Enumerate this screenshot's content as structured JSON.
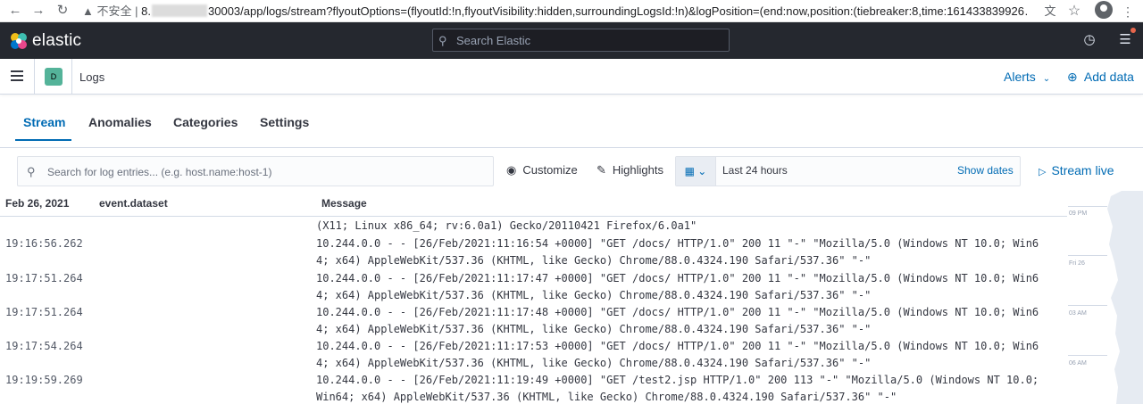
{
  "browser": {
    "security_label": "不安全",
    "host_prefix": "8.",
    "url_path": "30003/app/logs/stream?flyoutOptions=(flyoutId:!n,flyoutVisibility:hidden,surroundingLogsId:!n)&logPosition=(end:now,position:(tiebreaker:8,time:161433839926…",
    "back_icon": "arrow-left-icon",
    "forward_icon": "arrow-right-icon",
    "reload_icon": "reload-icon",
    "translate_icon": "translate-icon",
    "star_icon": "star-icon",
    "menu_icon": "kebab-icon"
  },
  "header": {
    "logo_text": "elastic",
    "search_placeholder": "Search Elastic"
  },
  "appbar": {
    "space_initial": "D",
    "breadcrumb": "Logs",
    "alerts_label": "Alerts",
    "add_data_label": "Add data"
  },
  "tabs": [
    {
      "label": "Stream",
      "active": true
    },
    {
      "label": "Anomalies",
      "active": false
    },
    {
      "label": "Categories",
      "active": false
    },
    {
      "label": "Settings",
      "active": false
    }
  ],
  "toolbar": {
    "search_placeholder": "Search for log entries... (e.g. host.name:host-1)",
    "customize_label": "Customize",
    "highlights_label": "Highlights",
    "date_range_label": "Last 24 hours",
    "show_dates_label": "Show dates",
    "stream_live_label": "Stream live"
  },
  "table": {
    "columns": [
      "Feb 26, 2021",
      "event.dataset",
      "Message"
    ],
    "rows": [
      {
        "time": "",
        "message": "(X11; Linux x86_64; rv:6.0a1) Gecko/20110421 Firefox/6.0a1\""
      },
      {
        "time": "19:16:56.262",
        "message": "10.244.0.0 - - [26/Feb/2021:11:16:54 +0000] \"GET /docs/ HTTP/1.0\" 200 11 \"-\" \"Mozilla/5.0 (Windows NT 10.0; Win6\n4; x64) AppleWebKit/537.36 (KHTML, like Gecko) Chrome/88.0.4324.190 Safari/537.36\" \"-\""
      },
      {
        "time": "19:17:51.264",
        "message": "10.244.0.0 - - [26/Feb/2021:11:17:47 +0000] \"GET /docs/ HTTP/1.0\" 200 11 \"-\" \"Mozilla/5.0 (Windows NT 10.0; Win6\n4; x64) AppleWebKit/537.36 (KHTML, like Gecko) Chrome/88.0.4324.190 Safari/537.36\" \"-\""
      },
      {
        "time": "19:17:51.264",
        "message": "10.244.0.0 - - [26/Feb/2021:11:17:48 +0000] \"GET /docs/ HTTP/1.0\" 200 11 \"-\" \"Mozilla/5.0 (Windows NT 10.0; Win6\n4; x64) AppleWebKit/537.36 (KHTML, like Gecko) Chrome/88.0.4324.190 Safari/537.36\" \"-\""
      },
      {
        "time": "19:17:54.264",
        "message": "10.244.0.0 - - [26/Feb/2021:11:17:53 +0000] \"GET /docs/ HTTP/1.0\" 200 11 \"-\" \"Mozilla/5.0 (Windows NT 10.0; Win6\n4; x64) AppleWebKit/537.36 (KHTML, like Gecko) Chrome/88.0.4324.190 Safari/537.36\" \"-\""
      },
      {
        "time": "19:19:59.269",
        "message": "10.244.0.0 - - [26/Feb/2021:11:19:49 +0000] \"GET /test2.jsp HTTP/1.0\" 200 113 \"-\" \"Mozilla/5.0 (Windows NT 10.0;\nWin64; x64) AppleWebKit/537.36 (KHTML, like Gecko) Chrome/88.0.4324.190 Safari/537.36\" \"-\""
      }
    ]
  },
  "minimap": {
    "labels": [
      "09 PM",
      "Fri 26",
      "03 AM",
      "06 AM"
    ]
  },
  "colors": {
    "accent": "#006bb4",
    "header_bg": "#25282f",
    "space_avatar": "#54b399"
  }
}
